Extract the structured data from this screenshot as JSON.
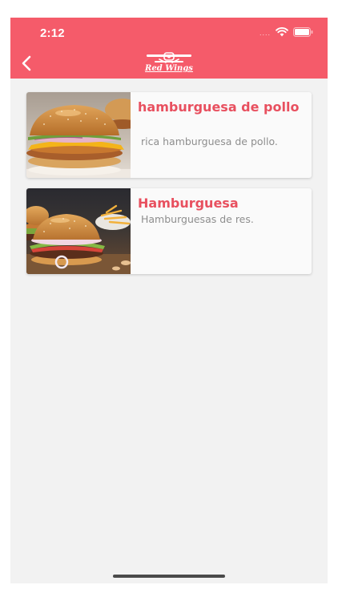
{
  "status_bar": {
    "time": "2:12",
    "signal": "....",
    "icons": [
      "wifi-icon",
      "battery-icon"
    ]
  },
  "header": {
    "back_icon": "chevron-left-icon",
    "logo_text": "Red Wings",
    "background_color": "#f55b6a"
  },
  "products": [
    {
      "title": "hamburguesa de pollo",
      "description": "rica hamburguesa de pollo.",
      "image": "chicken-burger-photo"
    },
    {
      "title": "Hamburguesa",
      "description": "Hamburguesas de res.",
      "image": "beef-burgers-photo"
    }
  ],
  "colors": {
    "accent": "#e8505f",
    "screen_background": "#f2f2f2",
    "card_background": "#fafafa",
    "description_text": "#8e8e8e"
  }
}
